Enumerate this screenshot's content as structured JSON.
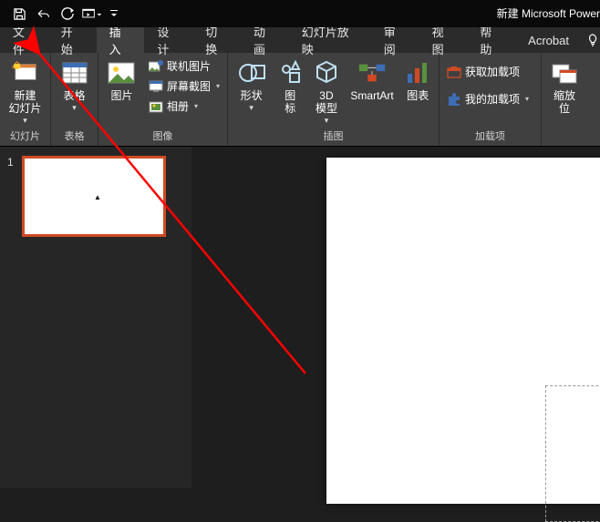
{
  "title": "新建 Microsoft Power",
  "tabs": [
    "文件",
    "开始",
    "插入",
    "设计",
    "切换",
    "动画",
    "幻灯片放映",
    "审阅",
    "视图",
    "帮助",
    "Acrobat"
  ],
  "active_tab_index": 2,
  "ribbon": {
    "groups": {
      "slides": {
        "label": "幻灯片",
        "new_slide": "新建\n幻灯片"
      },
      "tables": {
        "label": "表格",
        "table": "表格"
      },
      "images": {
        "label": "图像",
        "picture": "图片",
        "online_pictures": "联机图片",
        "screenshot": "屏幕截图",
        "photo_album": "相册"
      },
      "illustrations": {
        "label": "插图",
        "shapes": "形状",
        "icons": "图\n标",
        "model3d": "3D\n模型",
        "smartart": "SmartArt",
        "chart": "图表"
      },
      "addins": {
        "label": "加载项",
        "get_addins": "获取加载项",
        "my_addins": "我的加载项"
      },
      "zoom": {
        "scale": "缩放\n位"
      }
    }
  },
  "thumb": {
    "number": "1",
    "mark": "▲"
  }
}
